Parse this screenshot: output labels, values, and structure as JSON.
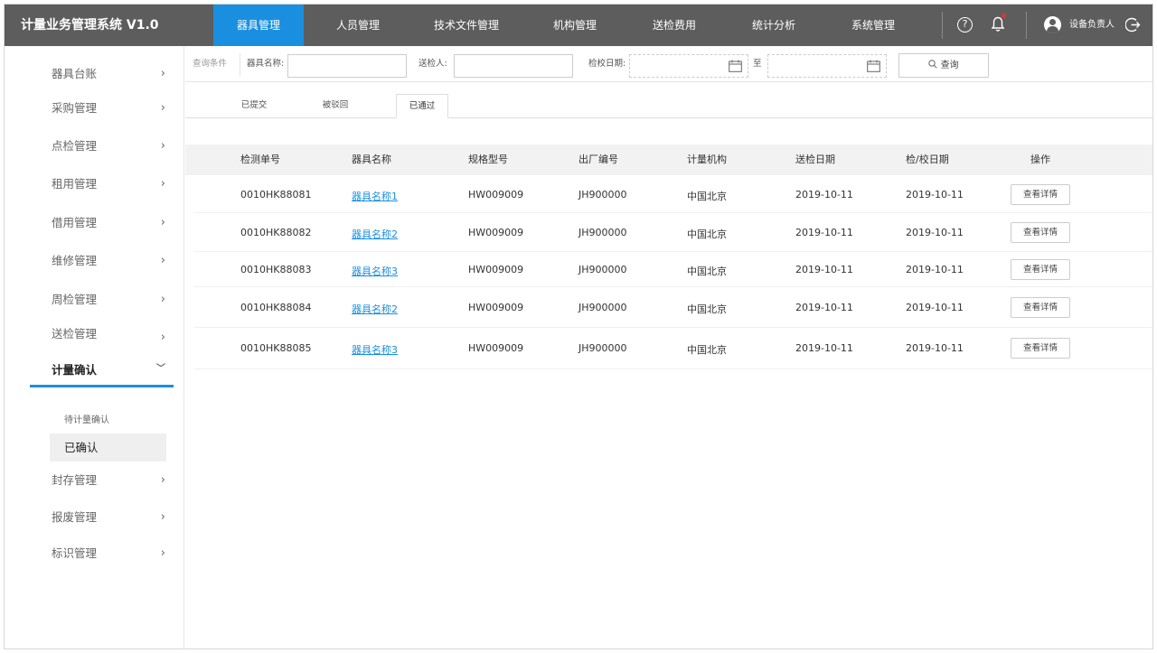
{
  "app": {
    "title": "计量业务管理系统 V1.0"
  },
  "nav": {
    "items": [
      "器具管理",
      "人员管理",
      "技术文件管理",
      "机构管理",
      "送检费用",
      "统计分析",
      "系统管理"
    ],
    "active_index": 0,
    "active_color": "#1a8fe0"
  },
  "header": {
    "user": "设备负责人",
    "notification_badge_color": "#e8322f"
  },
  "sidebar": {
    "items": [
      "器具台账",
      "采购管理",
      "点检管理",
      "租用管理",
      "借用管理",
      "维修管理",
      "周检管理",
      "送检管理",
      "计量确认",
      "封存管理",
      "报废管理",
      "标识管理"
    ],
    "open_item": "计量确认",
    "sub_items": [
      "待计量确认",
      "已确认"
    ],
    "active_sub_item": "已确认"
  },
  "filter": {
    "section_label": "查询条件",
    "name_label": "器具名称:",
    "name_value": "",
    "sender_label": "送检人:",
    "sender_value": "",
    "date_label": "检校日期:",
    "date_to": "至",
    "search_button": "查询"
  },
  "tabs": {
    "items": [
      "已提交",
      "被驳回",
      "已通过"
    ],
    "active": "已通过"
  },
  "table": {
    "columns": [
      "检测单号",
      "器具名称",
      "规格型号",
      "出厂编号",
      "计量机构",
      "送检日期",
      "检/校日期",
      "操作"
    ],
    "rows": [
      [
        "0010HK88081",
        "器具名称1",
        "HW009009",
        "JH900000",
        "中国北京",
        "2019-10-11",
        "2019-10-11",
        "查看详情"
      ],
      [
        "0010HK88082",
        "器具名称2",
        "HW009009",
        "JH900000",
        "中国北京",
        "2019-10-11",
        "2019-10-11",
        "查看详情"
      ],
      [
        "0010HK88083",
        "器具名称3",
        "HW009009",
        "JH900000",
        "中国北京",
        "2019-10-11",
        "2019-10-11",
        "查看详情"
      ],
      [
        "0010HK88084",
        "器具名称2",
        "HW009009",
        "JH900000",
        "中国北京",
        "2019-10-11",
        "2019-10-11",
        "查看详情"
      ],
      [
        "0010HK88085",
        "器具名称3",
        "HW009009",
        "JH900000",
        "中国北京",
        "2019-10-11",
        "2019-10-11",
        "查看详情"
      ]
    ]
  }
}
